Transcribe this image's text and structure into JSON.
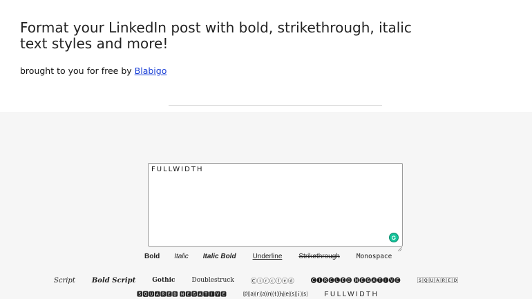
{
  "hero": {
    "title": "Format your LinkedIn post with bold, strikethrough, italic text styles and more!",
    "byline_prefix": "brought to you for free by ",
    "byline_link": "Blabigo"
  },
  "editor": {
    "value": "FULLWIDTH"
  },
  "styles_row1": [
    {
      "label": "Bold"
    },
    {
      "label": "Italic"
    },
    {
      "label": "Italic Bold"
    },
    {
      "label": "Underline"
    },
    {
      "label": "Strikethrough"
    },
    {
      "label": "Monospace"
    }
  ],
  "styles_row2": [
    {
      "label": "Script"
    },
    {
      "label": "Bold Script"
    },
    {
      "label": "Gothic"
    },
    {
      "label": "Doublestruck"
    },
    {
      "label": "Ⓒⓘⓡⓒⓛⓔⓓ"
    },
    {
      "label": "🅒🅘🅡🅒🅛🅔🅓 🅝🅔🅖🅐🅣🅘🅥🅔"
    },
    {
      "label": "🅂🅀🅄🄰🅁🄴🄳"
    }
  ],
  "styles_row3": [
    {
      "label": "🆂🆀🆄🅰🆁🅴🅳 🅽🅴🅶🅰🆃🅸🆅🅴"
    },
    {
      "label": "⒫⒜⒭⒜⒩⒯⒣⒠⒮⒤⒮"
    },
    {
      "label": "FULLWIDTH"
    }
  ],
  "colors": {
    "panel_bg": "#f6f6f6",
    "link": "#1a3fd6",
    "grammarly": "#15c39a"
  },
  "icons": [
    "grammarly-icon",
    "resize-grip-icon"
  ]
}
